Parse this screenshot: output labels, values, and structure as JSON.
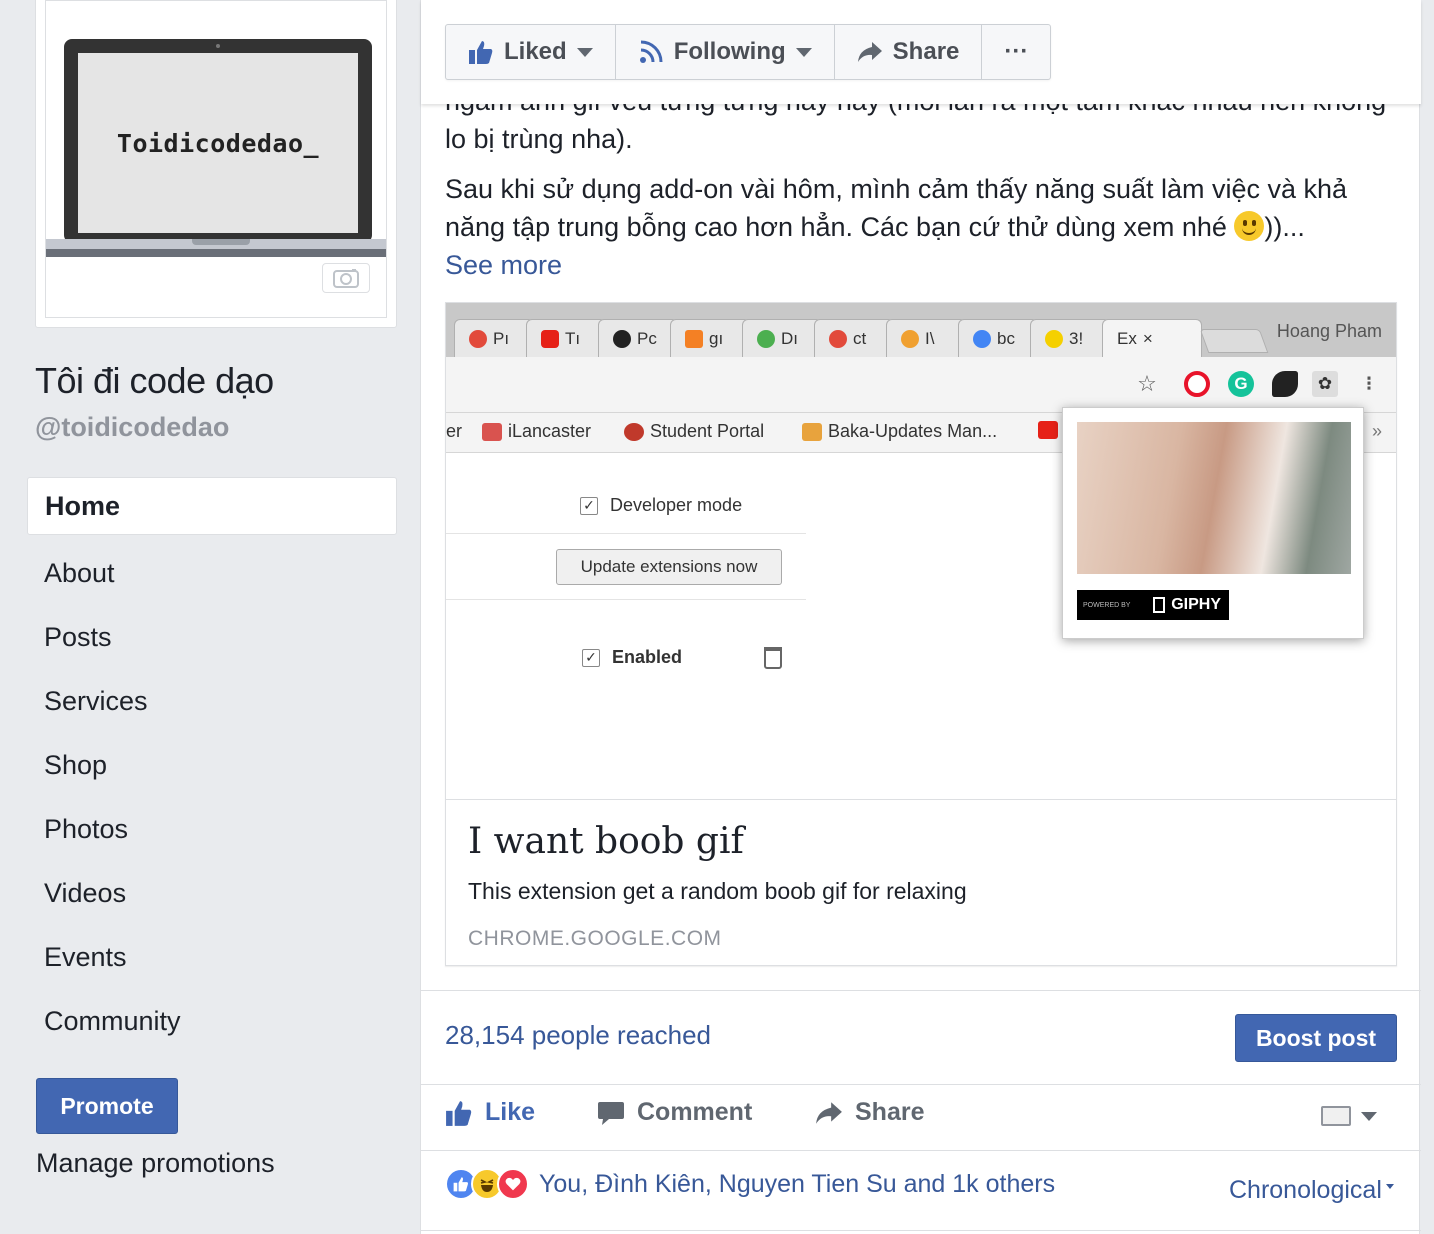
{
  "page": {
    "profile_image_text": "Toidicodedao_",
    "name": "Tôi đi code dạo",
    "handle": "@toidicodedao"
  },
  "nav": {
    "items": [
      {
        "label": "Home",
        "active": true
      },
      {
        "label": "About"
      },
      {
        "label": "Posts"
      },
      {
        "label": "Services"
      },
      {
        "label": "Shop"
      },
      {
        "label": "Photos"
      },
      {
        "label": "Videos"
      },
      {
        "label": "Events"
      },
      {
        "label": "Community"
      }
    ]
  },
  "promote": {
    "button_label": "Promote",
    "manage_label": "Manage promotions"
  },
  "action_bar": {
    "liked_label": "Liked",
    "following_label": "Following",
    "share_label": "Share",
    "more_label": "···"
  },
  "post": {
    "paragraph_top": "ngắm ảnh gif vếu tưng tưng hay hay (mỗi lần ra một tấm khác nhau nên không lo bị trùng nha).",
    "paragraph_main": "Sau khi sử dụng add-on vài hôm, mình cảm thấy năng suất làm việc và khả năng tập trung bỗng cao hơn hẳn. Các bạn cứ thử dùng xem nhé",
    "paragraph_tail": "))...",
    "see_more": "See more"
  },
  "screenshot": {
    "tabs": [
      "Pı",
      "Tı",
      "Pc",
      "gı",
      "Dı",
      "ct",
      "I\\",
      "bc",
      "3!",
      "Ex"
    ],
    "user": "Hoang Pham",
    "bookmarks": [
      "er",
      "iLancaster",
      "Student Portal",
      "Baka-Updates Man..."
    ],
    "developer_mode": "Developer mode",
    "update_button": "Update extensions now",
    "enabled_label": "Enabled",
    "giphy_powered": "POWERED BY",
    "giphy_label": "GIPHY",
    "overflow": "»"
  },
  "link_card": {
    "title": "I want boob gif",
    "description": "This extension get a random boob gif for relaxing",
    "domain": "CHROME.GOOGLE.COM"
  },
  "insights": {
    "reached": "28,154 people reached",
    "boost_label": "Boost post"
  },
  "post_actions": {
    "like": "Like",
    "comment": "Comment",
    "share": "Share"
  },
  "reactions": {
    "summary": "You, Đình Kiên, Nguyen Tien Su and 1k others",
    "sort_label": "Chronological"
  },
  "colors": {
    "facebook_blue": "#4267b2",
    "link_blue": "#385898",
    "background": "#e9ebee"
  }
}
